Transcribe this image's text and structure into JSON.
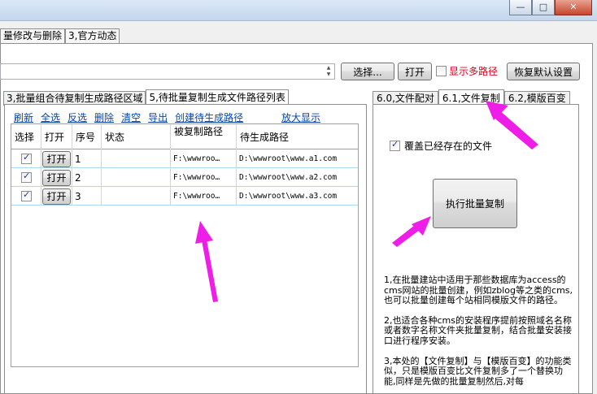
{
  "window": {
    "minimize_icon": "minimize-icon",
    "maximize_icon": "maximize-icon",
    "close_icon": "close-icon"
  },
  "top_tabs": [
    {
      "label": "量修改与删除"
    },
    {
      "label": "3,官方动态"
    }
  ],
  "path_bar": {
    "value": "",
    "choose_label": "选择...",
    "open_label": "打开",
    "multi_path_label": "显示多路径",
    "multi_path_checked": false,
    "restore_label": "恢复默认设置"
  },
  "left_tabs": [
    {
      "label": "3,批量组合待复制生成路径区域",
      "active": false
    },
    {
      "label": "5,待批量复制生成文件路径列表",
      "active": true
    }
  ],
  "actions": {
    "refresh": "刷新",
    "select_all": "全选",
    "invert": "反选",
    "delete": "删除",
    "clear": "清空",
    "export": "导出",
    "create_paths": "创建待生成路径",
    "zoom": "放大显示"
  },
  "grid": {
    "headers": [
      "选择",
      "打开",
      "序号",
      "状态",
      "被复制路径",
      "待生成路径"
    ],
    "open_label": "打开",
    "rows": [
      {
        "checked": true,
        "index": "1",
        "status": "",
        "source": "F:\\wwwroo…",
        "target": "D:\\wwwroot\\www.a1.com"
      },
      {
        "checked": true,
        "index": "2",
        "status": "",
        "source": "F:\\wwwroo…",
        "target": "D:\\wwwroot\\www.a2.com"
      },
      {
        "checked": true,
        "index": "3",
        "status": "",
        "source": "F:\\wwwroo…",
        "target": "D:\\wwwroot\\www.a3.com"
      }
    ]
  },
  "right_tabs": [
    {
      "label": "6.0,文件配对",
      "active": false
    },
    {
      "label": "6.1,文件复制",
      "active": true
    },
    {
      "label": "6.2,模版百变",
      "active": false
    }
  ],
  "right_panel": {
    "overwrite_label": "覆盖已经存在的文件",
    "overwrite_checked": true,
    "execute_label": "执行批量复制",
    "note1": "1,在批量建站中适用于那些数据库为access的cms网站的批量创建，例如zblog等之类的cms,也可以批量创建每个站相同模版文件的路径。",
    "note2": "2,也适合各种cms的安装程序提前按照域名名称或者数字名称文件夹批量复制，结合批量安装接口进行程序安装。",
    "note3": "3,本处的【文件复制】与【模版百变】的功能类似，只是模版百变比文件复制多了一个替换功能,同样是先做的批量复制然后,对每"
  },
  "colors": {
    "arrow": "#ee1ee8",
    "link": "#0645ad",
    "warning_text": "#e0001c"
  }
}
